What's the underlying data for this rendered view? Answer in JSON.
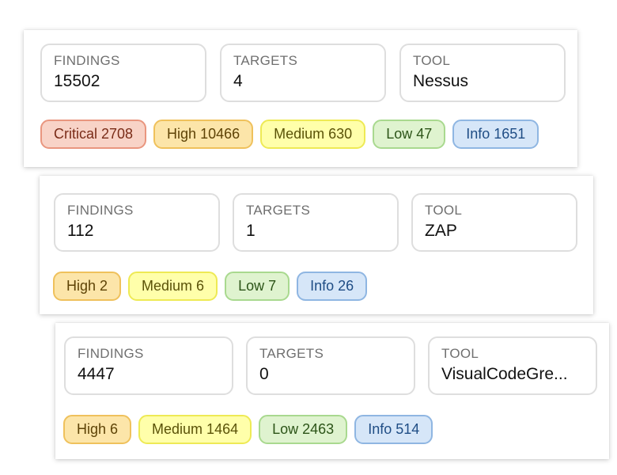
{
  "cards": [
    {
      "findings": {
        "label": "FINDINGS",
        "value": "15502"
      },
      "targets": {
        "label": "TARGETS",
        "value": "4"
      },
      "tool": {
        "label": "TOOL",
        "value": "Nessus"
      },
      "badges": {
        "critical": "Critical 2708",
        "high": "High 10466",
        "medium": "Medium 630",
        "low": "Low 47",
        "info": "Info 1651"
      }
    },
    {
      "findings": {
        "label": "FINDINGS",
        "value": "112"
      },
      "targets": {
        "label": "TARGETS",
        "value": "1"
      },
      "tool": {
        "label": "TOOL",
        "value": "ZAP"
      },
      "badges": {
        "high": "High 2",
        "medium": "Medium 6",
        "low": "Low 7",
        "info": "Info 26"
      }
    },
    {
      "findings": {
        "label": "FINDINGS",
        "value": "4447"
      },
      "targets": {
        "label": "TARGETS",
        "value": "0"
      },
      "tool": {
        "label": "TOOL",
        "value": "VisualCodeGre..."
      },
      "badges": {
        "high": "High 6",
        "medium": "Medium 1464",
        "low": "Low 2463",
        "info": "Info 514"
      }
    }
  ],
  "colors": {
    "critical": "#f8d3c7",
    "high": "#fce5a9",
    "medium": "#ffffaa",
    "low": "#dff3cf",
    "info": "#d6e6f8"
  }
}
